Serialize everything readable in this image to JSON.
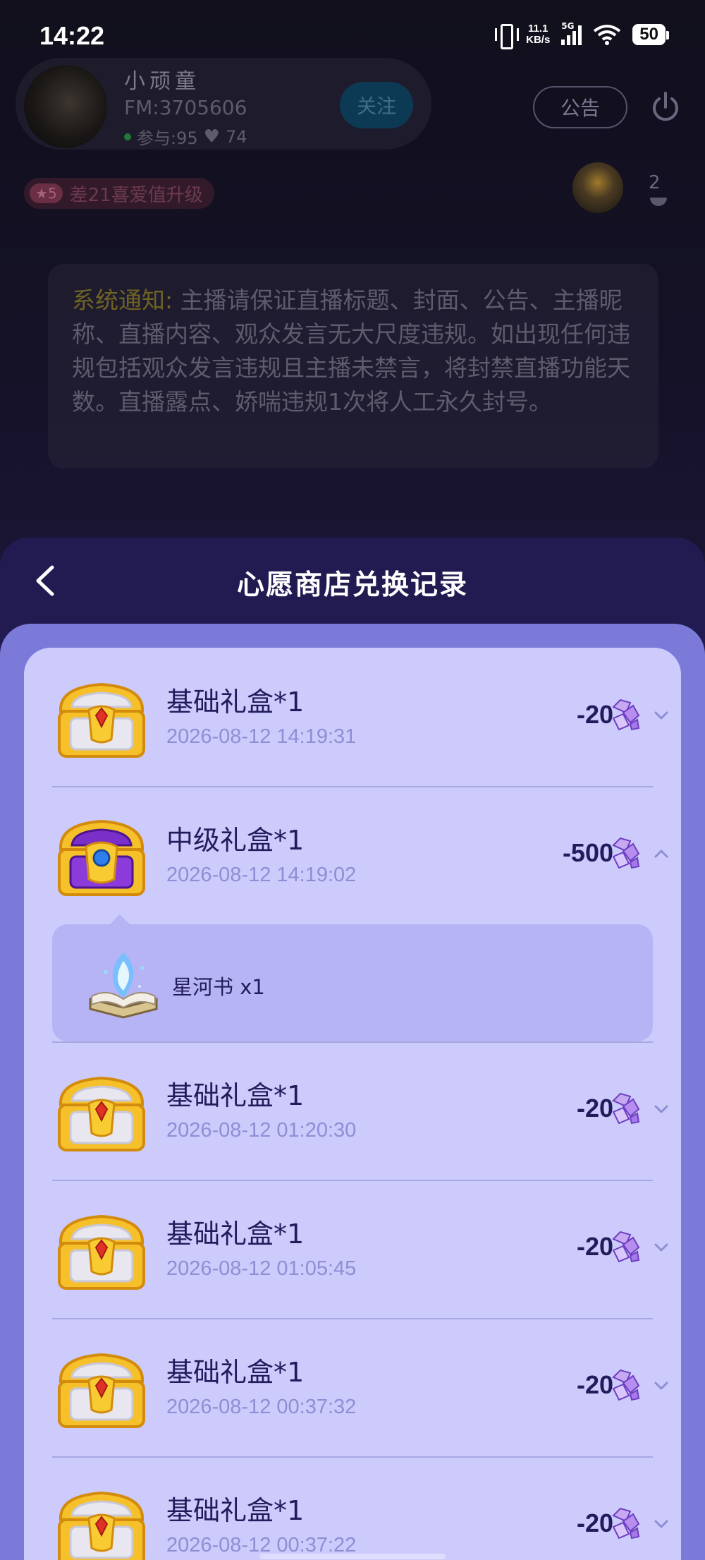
{
  "status_bar": {
    "time": "14:22",
    "net_speed_value": "11.1",
    "net_speed_unit": "KB/s",
    "network_type": "5G",
    "battery": "50"
  },
  "host": {
    "name": "小顽童",
    "fm_id": "FM:3705606",
    "participants": "参与:95",
    "likes": "74",
    "follow_label": "关注"
  },
  "top_controls": {
    "notice_label": "公告",
    "level_badge": "5",
    "level_hint": "差21喜爱值升级",
    "viewer_count": "2"
  },
  "system_notice": {
    "tag": "系统通知:",
    "text": " 主播请保证直播标题、封面、公告、主播昵称、直播内容、观众发言无大尺度违规。如出现任何违规包括观众发言违规且主播未禁言，将封禁直播功能天数。直播露点、娇喘违规1次将人工永久封号。"
  },
  "sheet": {
    "title": "心愿商店兑换记录",
    "records": [
      {
        "name": "基础礼盒*1",
        "time": "2026-08-12 14:19:31",
        "cost": "-20",
        "chest": "gold-chest-icon",
        "expanded": false
      },
      {
        "name": "中级礼盒*1",
        "time": "2026-08-12 14:19:02",
        "cost": "-500",
        "chest": "purple-chest-icon",
        "expanded": true,
        "detail": {
          "reward": "星河书 x1",
          "icon": "star-river-book-icon"
        }
      },
      {
        "name": "基础礼盒*1",
        "time": "2026-08-12 01:20:30",
        "cost": "-20",
        "chest": "gold-chest-icon",
        "expanded": false
      },
      {
        "name": "基础礼盒*1",
        "time": "2026-08-12 01:05:45",
        "cost": "-20",
        "chest": "gold-chest-icon",
        "expanded": false
      },
      {
        "name": "基础礼盒*1",
        "time": "2026-08-12 00:37:32",
        "cost": "-20",
        "chest": "gold-chest-icon",
        "expanded": false
      },
      {
        "name": "基础礼盒*1",
        "time": "2026-08-12 00:37:22",
        "cost": "-20",
        "chest": "gold-chest-icon",
        "expanded": false
      }
    ]
  },
  "colors": {
    "sheet_header": "#221b52",
    "sheet_body": "#7b7ad8",
    "card": "#cccbfc",
    "text_primary": "#221c5c",
    "text_secondary": "#8f8ed4"
  }
}
